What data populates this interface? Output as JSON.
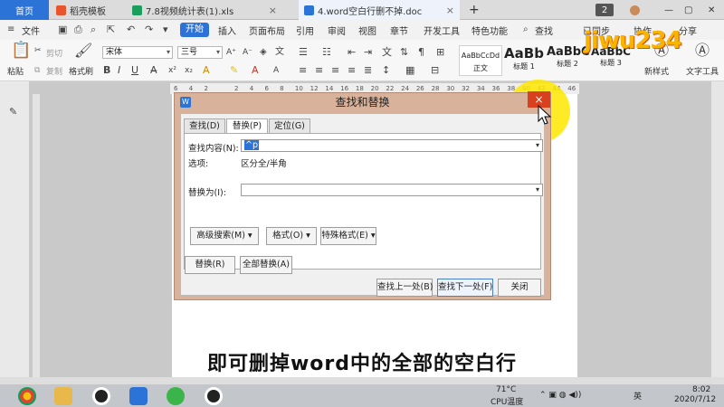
{
  "tabs": [
    {
      "label": "首页",
      "active": true
    },
    {
      "label": "稻壳模板"
    },
    {
      "label": "7.8视频统计表(1).xls"
    },
    {
      "label": "4.word空白行删不掉.doc"
    }
  ],
  "tab_badge": "2",
  "menu": {
    "file": "文件",
    "start": "开始",
    "items": [
      "插入",
      "页面布局",
      "引用",
      "审阅",
      "视图",
      "章节",
      "开发工具",
      "特色功能"
    ],
    "search": "查找",
    "sync": "已同步",
    "collab": "协作",
    "share": "分享"
  },
  "toolbar": {
    "paste": "粘贴",
    "cut": "剪切",
    "copy": "复制",
    "format_painter": "格式刷",
    "font": "宋体",
    "size": "三号",
    "styles": [
      {
        "sample": "AaBbCcDd",
        "name": "正文"
      },
      {
        "sample": "AaBb",
        "name": "标题 1"
      },
      {
        "sample": "AaBbC",
        "name": "标题 2"
      },
      {
        "sample": "AaBbC",
        "name": "标题 3"
      }
    ],
    "new_style": "新样式",
    "text_tools": "文字工具"
  },
  "ruler_ticks": [
    "6",
    "4",
    "2",
    "",
    "2",
    "4",
    "6",
    "8",
    "10",
    "12",
    "14",
    "16",
    "18",
    "20",
    "22",
    "24",
    "26",
    "28",
    "30",
    "32",
    "34",
    "36",
    "38",
    "40",
    "42",
    "44",
    "46"
  ],
  "dialog": {
    "title": "查找和替换",
    "close": "×",
    "tabs": [
      "查找(D)",
      "替换(P)",
      "定位(G)"
    ],
    "find_label": "查找内容(N):",
    "find_value": "^p",
    "options_label": "选项:",
    "options_value": "区分全/半角",
    "replace_label": "替换为(I):",
    "replace_value": "",
    "advanced": "高级搜索(M)",
    "format": "格式(O)",
    "special": "特殊格式(E)",
    "replace_btn": "替换(R)",
    "replace_all_btn": "全部替换(A)",
    "find_prev": "查找上一处(B)",
    "find_next": "查找下一处(F)",
    "close_btn": "关闭"
  },
  "subtitle": "即可删掉word中的全部的空白行",
  "watermark": "jiwu234",
  "taskbar": {
    "temp": "71°C",
    "cpu": "CPU温度",
    "ime": "英",
    "time": "8:02",
    "date": "2020/7/12"
  },
  "colors": {
    "accent": "#2b73d6",
    "dialog_frame": "#d9b29b",
    "close": "#d9411e",
    "highlight": "#ffe600"
  }
}
